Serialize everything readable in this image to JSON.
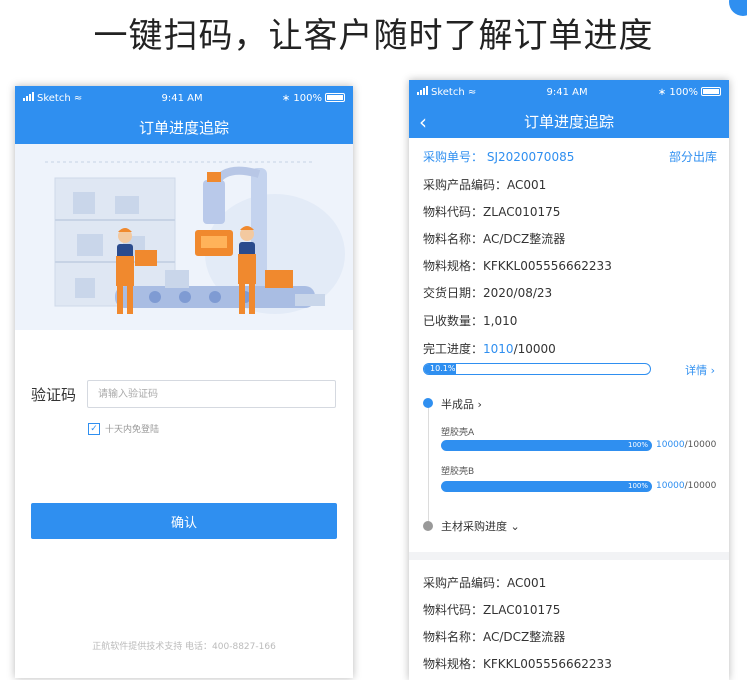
{
  "headline": "一键扫码，让客户随时了解订单进度",
  "left_phone": {
    "status": {
      "carrier": "Sketch",
      "time": "9:41 AM",
      "battery": "100%"
    },
    "nav_title": "订单进度追踪",
    "form": {
      "label": "验证码",
      "placeholder": "请输入验证码",
      "remember_label": "十天内免登陆",
      "remember_checked": true
    },
    "confirm_label": "确认",
    "footer": "正航软件提供技术支持 电话：400-8827-166"
  },
  "right_phone": {
    "status": {
      "carrier": "Sketch",
      "time": "9:41 AM",
      "battery": "100%"
    },
    "nav_title": "订单进度追踪",
    "order": {
      "number_label": "采购单号：",
      "number_value": "SJ2020070085",
      "status": "部分出库",
      "product_code_label": "采购产品编码：",
      "product_code_value": "AC001",
      "material_code_label": "物料代码：",
      "material_code_value": "ZLAC010175",
      "material_name_label": "物料名称：",
      "material_name_value": "AC/DCZ整流器",
      "spec_label": "物料规格：",
      "spec_value": "KFKKL005556662233",
      "delivery_label": "交货日期：",
      "delivery_value": "2020/08/23",
      "received_label": "已收数量：",
      "received_value": "1,010",
      "completion_label": "完工进度：",
      "completion_done": "1010",
      "completion_total": "/10000",
      "completion_percent_text": "10.1%",
      "completion_fraction": 0.101,
      "detail_link": "详情 ›"
    },
    "timeline": {
      "semi_title": "半成品 ›",
      "items": [
        {
          "name": "塑胶壳A",
          "percent_text": "100%",
          "done": "10000",
          "total": "/10000",
          "fraction": 1.0
        },
        {
          "name": "塑胶壳B",
          "percent_text": "100%",
          "done": "10000",
          "total": "/10000",
          "fraction": 1.0
        }
      ],
      "main_material_title": "主材采购进度 ⌄"
    },
    "second_order": {
      "product_code_label": "采购产品编码：",
      "product_code_value": "AC001",
      "material_code_label": "物料代码：",
      "material_code_value": "ZLAC010175",
      "material_name_label": "物料名称：",
      "material_name_value": "AC/DCZ整流器",
      "spec_label": "物料规格：",
      "spec_value": "KFKKL005556662233"
    }
  },
  "colors": {
    "accent": "#2f8ff0",
    "illustration_bg": "#eef3fb",
    "worker_orange": "#f0892e"
  }
}
